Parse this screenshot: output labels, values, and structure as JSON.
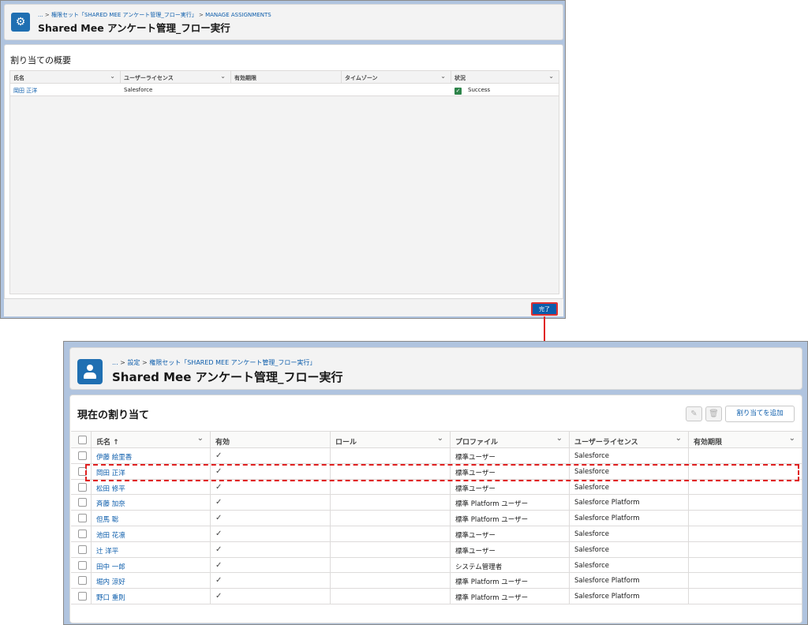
{
  "top": {
    "breadcrumb": [
      "...",
      "権限セット「SHARED MEE アンケート管理_フロー実行」",
      "MANAGE ASSIGNMENTS"
    ],
    "title": "Shared Mee アンケート管理_フロー実行",
    "card_title": "割り当ての概要",
    "columns": [
      "氏名",
      "ユーザーライセンス",
      "有効期限",
      "タイムゾーン",
      "状況"
    ],
    "rows": [
      {
        "name": "岡田 正洋",
        "license": "Salesforce",
        "expiry": "",
        "timezone": "",
        "status": "Success"
      }
    ],
    "done_label": "完了"
  },
  "bottom": {
    "breadcrumb": [
      "...",
      "設定",
      "権限セット「SHARED MEE アンケート管理_フロー実行」"
    ],
    "title": "Shared Mee アンケート管理_フロー実行",
    "card_title": "現在の割り当て",
    "add_label": "割り当てを追加",
    "columns": [
      "氏名 ↑",
      "有効",
      "ロール",
      "プロファイル",
      "ユーザーライセンス",
      "有効期限"
    ],
    "rows": [
      {
        "name": "伊藤 絵里香",
        "active": "✓",
        "role": "",
        "profile": "標準ユーザー",
        "license": "Salesforce",
        "expiry": ""
      },
      {
        "name": "岡田 正洋",
        "active": "✓",
        "role": "",
        "profile": "標準ユーザー",
        "license": "Salesforce",
        "expiry": ""
      },
      {
        "name": "松田 修平",
        "active": "✓",
        "role": "",
        "profile": "標準ユーザー",
        "license": "Salesforce",
        "expiry": ""
      },
      {
        "name": "斉藤 加奈",
        "active": "✓",
        "role": "",
        "profile": "標準 Platform ユーザー",
        "license": "Salesforce Platform",
        "expiry": ""
      },
      {
        "name": "但馬 聡",
        "active": "✓",
        "role": "",
        "profile": "標準 Platform ユーザー",
        "license": "Salesforce Platform",
        "expiry": ""
      },
      {
        "name": "池田 花凛",
        "active": "✓",
        "role": "",
        "profile": "標準ユーザー",
        "license": "Salesforce",
        "expiry": ""
      },
      {
        "name": "辻 洋平",
        "active": "✓",
        "role": "",
        "profile": "標準ユーザー",
        "license": "Salesforce",
        "expiry": ""
      },
      {
        "name": "田中 一郎",
        "active": "✓",
        "role": "",
        "profile": "システム管理者",
        "license": "Salesforce",
        "expiry": ""
      },
      {
        "name": "堀内 涼好",
        "active": "✓",
        "role": "",
        "profile": "標準 Platform ユーザー",
        "license": "Salesforce Platform",
        "expiry": ""
      },
      {
        "name": "野口 重則",
        "active": "✓",
        "role": "",
        "profile": "標準 Platform ユーザー",
        "license": "Salesforce Platform",
        "expiry": ""
      }
    ]
  },
  "colors": {
    "brand": "#0b5cab",
    "highlight": "#e02020",
    "success": "#2e844a"
  }
}
